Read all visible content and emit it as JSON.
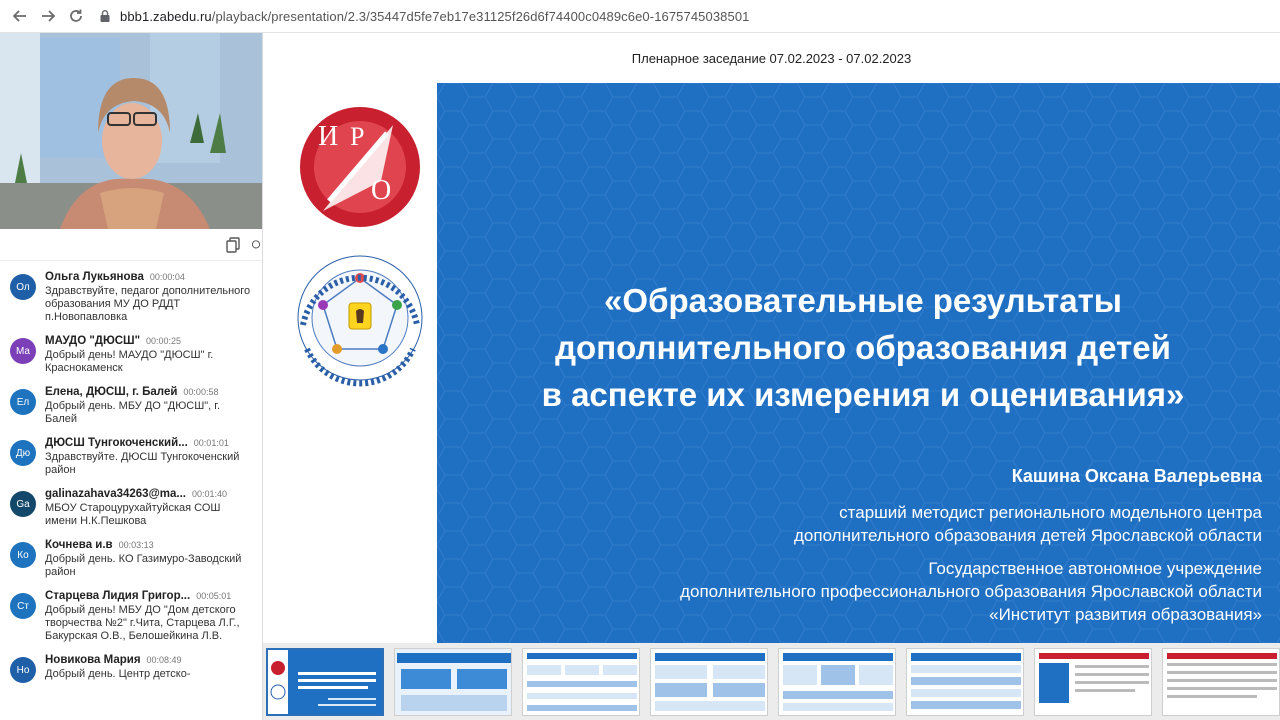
{
  "browser": {
    "url_host": "bbb1.zabedu.ru",
    "url_path": "/playback/presentation/2.3/35447d5fe7eb17e31125f26d6f74400c0489c6e0-1675745038501"
  },
  "presentation": {
    "title": "Пленарное заседание 07.02.2023 - 07.02.2023"
  },
  "slide": {
    "heading_line1": "«Образовательные результаты",
    "heading_line2": "дополнительного образования детей",
    "heading_line3": "в аспекте их измерения и оценивания»",
    "author": "Кашина Оксана Валерьевна",
    "position_line1": "старший методист регионального модельного центра",
    "position_line2": "дополнительного образования детей Ярославской области",
    "org_line1": "Государственное автономное учреждение",
    "org_line2": "дополнительного профессионального образования Ярославской области",
    "org_line3": "«Институт развития образования»",
    "logo_text": "ИРО",
    "emblem_text": "ДОПОЛНИТЕЛЬНОЕ ОБРАЗОВАНИЕ ДЕТЕЙ · РЕГИОНАЛЬНЫЙ МОДЕЛЬНЫЙ ЦЕНТР"
  },
  "chat": [
    {
      "initials": "Ол",
      "color": "#1f5fa8",
      "name": "Ольга Лукьянова",
      "time": "00:00:04",
      "text": "Здравствуйте, педагог дополнительного образования МУ ДО РДДТ п.Новопавловка"
    },
    {
      "initials": "Ма",
      "color": "#7b3fb8",
      "name": "МАУДО \"ДЮСШ\"",
      "time": "00:00:25",
      "text": "Добрый день! МАУДО \"ДЮСШ\" г. Краснокаменск"
    },
    {
      "initials": "Ел",
      "color": "#1e73be",
      "name": "Елена, ДЮСШ, г. Балей",
      "time": "00:00:58",
      "text": "Добрый день. МБУ ДО \"ДЮСШ\", г. Балей"
    },
    {
      "initials": "Дю",
      "color": "#1e73be",
      "name": "ДЮСШ Тунгокоченский...",
      "time": "00:01:01",
      "text": "Здравствуйте. ДЮСШ Тунгокоченский район"
    },
    {
      "initials": "Ga",
      "color": "#13486b",
      "name": "galinazahava34263@ma...",
      "time": "00:01:40",
      "text": "МБОУ Староцурухайтуйская СОШ имени Н.К.Пешкова"
    },
    {
      "initials": "Ко",
      "color": "#1e73be",
      "name": "Кочнева и.в",
      "time": "00:03:13",
      "text": "Добрый день. КО Газимуро-Заводский район"
    },
    {
      "initials": "Ст",
      "color": "#1e73be",
      "name": "Старцева Лидия Григор...",
      "time": "00:05:01",
      "text": "Добрый день! МБУ ДО \"Дом детского творчества №2\" г.Чита, Старцева Л.Г., Бакурская О.В., Белошейкина Л.В."
    },
    {
      "initials": "Но",
      "color": "#1f5fa8",
      "name": "Новикова Мария",
      "time": "00:08:49",
      "text": "Добрый день. Центр детско-"
    }
  ]
}
